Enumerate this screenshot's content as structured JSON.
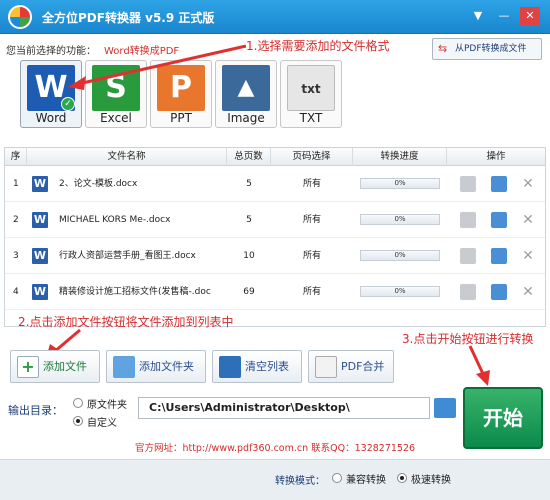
{
  "app": {
    "title": "全方位PDF转换器 v5.9 正式版"
  },
  "window_controls": {
    "menu": "▼",
    "minimize": "—",
    "close": "✕"
  },
  "function_row": {
    "label": "您当前选择的功能：",
    "value": "Word转换成PDF"
  },
  "annotations": {
    "step1": "1.选择需要添加的文件格式",
    "step2": "2.点击添加文件按钮将文件添加到列表中",
    "step3": "3.点击开始按钮进行转换"
  },
  "from_pdf_button": "从PDF转换成文件",
  "formats": [
    {
      "label": "Word",
      "glyph": "W",
      "color": "#1e5bb3",
      "selected": true
    },
    {
      "label": "Excel",
      "glyph": "S",
      "color": "#2a9b3c",
      "selected": false
    },
    {
      "label": "PPT",
      "glyph": "P",
      "color": "#e8762c",
      "selected": false
    },
    {
      "label": "Image",
      "glyph": "▲",
      "color": "#3b6a9a",
      "selected": false
    },
    {
      "label": "TXT",
      "glyph": "txt",
      "color": "#e6e6e6",
      "selected": false
    }
  ],
  "table": {
    "headers": [
      "序",
      "文件名称",
      "总页数",
      "页码选择",
      "转换进度",
      "操作"
    ],
    "rows": [
      {
        "index": "1",
        "name": "2、论文-模板.docx",
        "pages": "5",
        "selection": "所有",
        "progress": "0%"
      },
      {
        "index": "2",
        "name": "MICHAEL KORS Me-.docx",
        "pages": "5",
        "selection": "所有",
        "progress": "0%"
      },
      {
        "index": "3",
        "name": "行政人资部运营手册_看图王.docx",
        "pages": "10",
        "selection": "所有",
        "progress": "0%"
      },
      {
        "index": "4",
        "name": "精装修设计施工招标文件(发售稿-.doc",
        "pages": "69",
        "selection": "所有",
        "progress": "0%"
      }
    ]
  },
  "toolbar": {
    "add_file": "添加文件",
    "add_folder": "添加文件夹",
    "clear_list": "清空列表",
    "pdf_merge": "PDF合并"
  },
  "output": {
    "label": "输出目录：",
    "option_original": "原文件夹",
    "option_custom": "自定义",
    "selected": "custom",
    "path": "C:\\Users\\Administrator\\Desktop\\"
  },
  "start_button": "开始",
  "site": {
    "text": "官方网址：http://www.pdf360.com.cn    联系QQ：1328271526"
  },
  "footer": {
    "mode_label": "转换模式：",
    "mode_compat": "兼容转换",
    "mode_fast": "极速转换",
    "selected_mode": "fast"
  }
}
